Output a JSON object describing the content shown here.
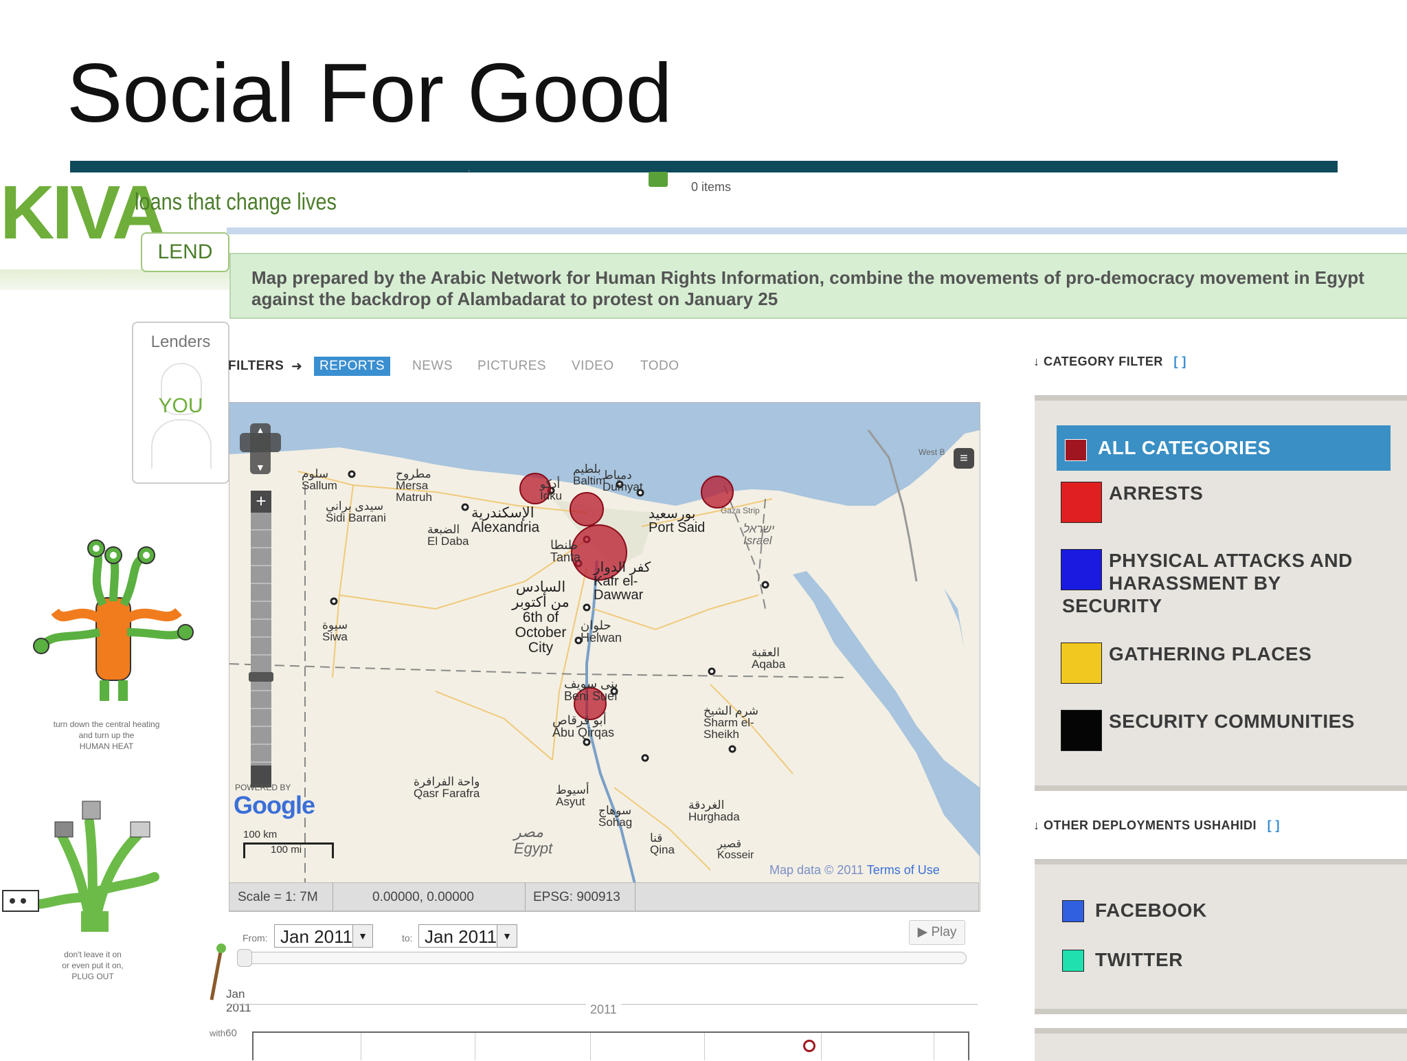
{
  "slide": {
    "title": "Social For Good"
  },
  "kiva": {
    "logo": "KIVA",
    "tagline": "loans that change lives",
    "lend_tab": "LEND",
    "lenders_label": "Lenders",
    "you_label": "YOU",
    "cart_items": "0 items",
    "caption_heating": "turn down the central heating\nand turn up the\nHUMAN HEAT",
    "caption_plug": "don't leave it on\nor even put it on,\nPLUG OUT"
  },
  "ushahidi": {
    "map_caption": "Map prepared by the Arabic Network for Human Rights Information, combine the movements of pro-democracy movement in Egypt against the backdrop of Alambadarat to protest on January 25",
    "filters": {
      "label": "FILTERS",
      "arrow": "➜",
      "tabs": [
        "REPORTS",
        "NEWS",
        "PICTURES",
        "VIDEO",
        "TODO"
      ],
      "active": "REPORTS"
    },
    "map": {
      "region": "Egypt",
      "attribution": "Map data © 2011",
      "terms": "Terms of Use",
      "powered_by": "POWERED BY",
      "google": "Google",
      "scale_km": "100 km",
      "scale_mi": "100 mi",
      "places": [
        {
          "ar": "سلوم",
          "en": "Sallum"
        },
        {
          "ar": "سيدى براني",
          "en": "Sidi Barrani"
        },
        {
          "ar": "مطروح",
          "en": "Mersa Matruh"
        },
        {
          "ar": "الضبعة",
          "en": "El Daba"
        },
        {
          "ar": "الإسكندرية",
          "en": "Alexandria"
        },
        {
          "ar": "أدكو",
          "en": "Idku"
        },
        {
          "ar": "بلطيم",
          "en": "Baltim"
        },
        {
          "ar": "دمياط",
          "en": "Dumyat"
        },
        {
          "ar": "بورسعيد",
          "en": "Port Said"
        },
        {
          "ar": "طنطا",
          "en": "Tanta"
        },
        {
          "ar": "كفر الدوار",
          "en": "Kafr el-Dawwar"
        },
        {
          "ar": "السادس من أكتوبر",
          "en": "6th of October City"
        },
        {
          "ar": "حلوان",
          "en": "Helwan"
        },
        {
          "ar": "سيوة",
          "en": "Siwa"
        },
        {
          "ar": "بنى سويف",
          "en": "Beni Suef"
        },
        {
          "ar": "أبو قرقاص",
          "en": "Abu Qirqas"
        },
        {
          "ar": "واحة الفرافرة",
          "en": "Qasr Farafra"
        },
        {
          "ar": "أسيوط",
          "en": "Asyut"
        },
        {
          "ar": "سوهاج",
          "en": "Sohag"
        },
        {
          "ar": "قنا",
          "en": "Qina"
        },
        {
          "ar": "قصير",
          "en": "Kosseir"
        },
        {
          "ar": "الغردقة",
          "en": "Hurghada"
        },
        {
          "ar": "شرم الشيخ",
          "en": "Sharm el-Sheikh"
        },
        {
          "ar": "العقبة",
          "en": "Aqaba"
        },
        {
          "ar": "ישראל",
          "en": "Israel"
        },
        {
          "ar": "مصر",
          "en": "Egypt"
        }
      ],
      "strip_label": "Gaza Strip",
      "west_bank": "West B"
    },
    "status_bar": {
      "scale": "Scale = 1: 7M",
      "coords": "0.00000, 0.00000",
      "epsg": "EPSG: 900913"
    },
    "timeline": {
      "from_label": "From:",
      "from_value": "Jan 2011",
      "to_label": "to:",
      "to_value": "Jan 2011",
      "play": "Play",
      "start_month": "Jan",
      "start_year": "2011",
      "year_label": "2011",
      "y_label": "with",
      "y_max": "60"
    },
    "category_filter": {
      "title": "CATEGORY FILTER",
      "toggle": "[ ]",
      "items": [
        {
          "label": "ALL CATEGORIES",
          "color": "#a01620"
        },
        {
          "label": "ARRESTS",
          "color": "#e02020"
        },
        {
          "label": "PHYSICAL ATTACKS AND HARASSMENT BY",
          "label2": "SECURITY",
          "color": "#1a1ae0"
        },
        {
          "label": "GATHERING PLACES",
          "color": "#f0c820"
        },
        {
          "label": "SECURITY COMMUNITIES",
          "color": "#050505"
        }
      ]
    },
    "other_deployments": {
      "title": "OTHER DEPLOYMENTS USHAHIDI",
      "toggle": "[ ]",
      "items": [
        {
          "label": "FACEBOOK",
          "color": "#3060e0"
        },
        {
          "label": "TWITTER",
          "color": "#20e0b0"
        }
      ]
    }
  }
}
